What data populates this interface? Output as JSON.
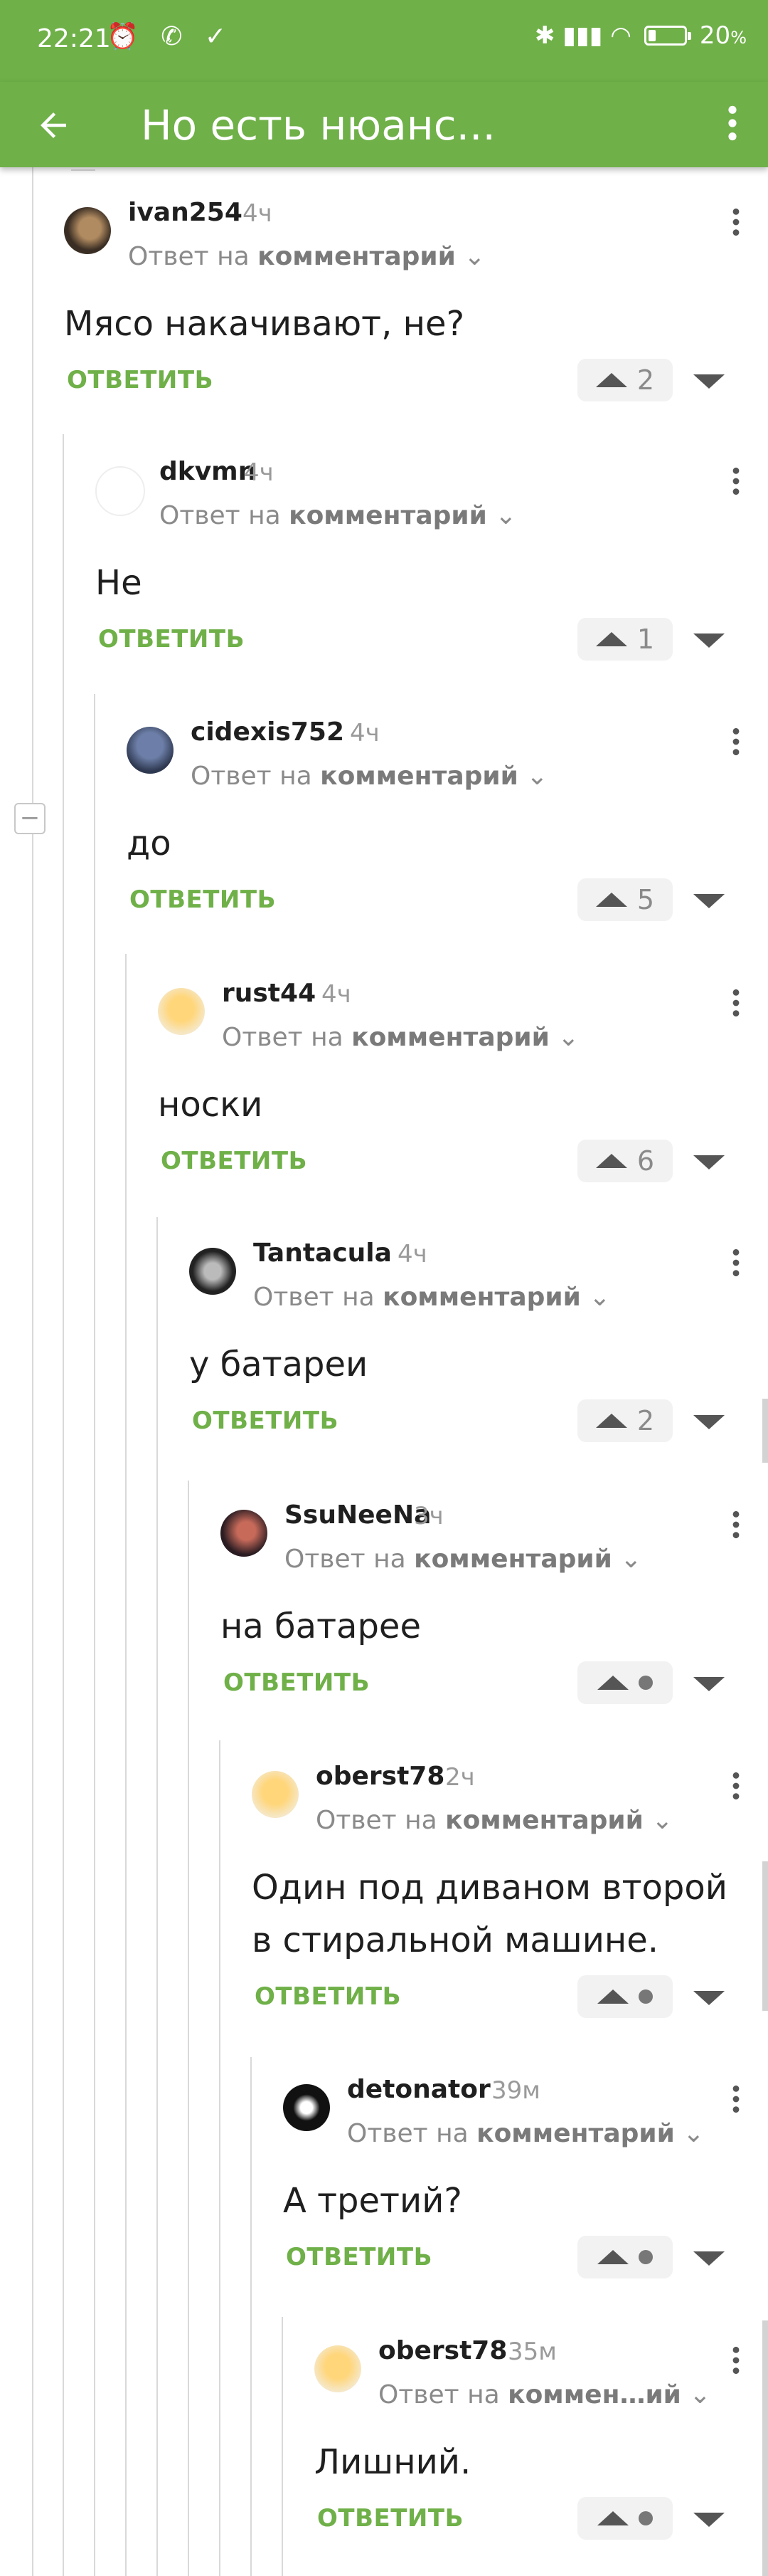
{
  "status_bar": {
    "time": "22:21",
    "icons_left": "⏰ ✆ ✓",
    "icons_right": "✱ ▮▮▮ ◠",
    "battery": "20",
    "battery_unit": "%",
    "battery_level": 0.2
  },
  "app_bar": {
    "title": "Но есть нюанс...",
    "back_icon": "arrow-left-icon",
    "more_icon": "more-vertical-icon"
  },
  "colors": {
    "accent": "#6fb048",
    "muted": "#9a9a9a",
    "vote_bg": "#f2f2f2"
  },
  "reply_label": "ОТВЕТИТЬ",
  "reply_prefix": "Ответ на",
  "reply_target": "комментарий",
  "comments": [
    {
      "author": "ivan254",
      "time": "4ч",
      "text": "Мясо накачивают, не?",
      "score": "2"
    },
    {
      "author": "dkvmn",
      "time": "4ч",
      "text": "Не",
      "score": "1"
    },
    {
      "author": "cidexis752",
      "time": "4ч",
      "text": "до",
      "score": "5"
    },
    {
      "author": "rust44",
      "time": "4ч",
      "text": "носки",
      "score": "6"
    },
    {
      "author": "Tantacula",
      "time": "4ч",
      "text": "у батареи",
      "score": "2"
    },
    {
      "author": "SsuNeeNa",
      "time": "3ч",
      "text": "на батарее",
      "score": ""
    },
    {
      "author": "oberst78",
      "time": "2ч",
      "text": "Один под диваном второй в стиральной машине.",
      "score": ""
    },
    {
      "author": "detonator",
      "time": "39м",
      "text": "А третий?",
      "score": ""
    },
    {
      "author": "oberst78",
      "time": "35м",
      "text": "Лишний.",
      "score": "",
      "reply_target_truncated": "коммен…ий"
    }
  ]
}
